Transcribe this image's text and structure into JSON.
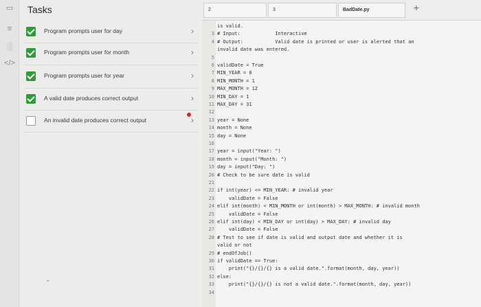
{
  "tasks": {
    "title": "Tasks",
    "items": [
      {
        "label": "Program prompts user for day",
        "done": true
      },
      {
        "label": "Program prompts user for month",
        "done": true
      },
      {
        "label": "Program prompts user for year",
        "done": true
      },
      {
        "label": "A valid date produces correct output",
        "done": true
      },
      {
        "label": "An invalid date produces correct output",
        "done": false
      }
    ]
  },
  "tabs": [
    {
      "label": "2"
    },
    {
      "label": "3"
    },
    {
      "label": "BadDate.py"
    }
  ],
  "editor": {
    "lines": [
      {
        "n": "",
        "t": "is valid."
      },
      {
        "n": "3",
        "t": "# Input:            Interactive"
      },
      {
        "n": "4",
        "t": "# Output:           Valid date is printed or user is alerted that an"
      },
      {
        "n": "",
        "t": "invalid date was entered."
      },
      {
        "n": "5",
        "t": ""
      },
      {
        "n": "6",
        "t": "validDate = True"
      },
      {
        "n": "7",
        "t": "MIN_YEAR = 0"
      },
      {
        "n": "8",
        "t": "MIN_MONTH = 1"
      },
      {
        "n": "9",
        "t": "MAX_MONTH = 12"
      },
      {
        "n": "10",
        "t": "MIN_DAY = 1"
      },
      {
        "n": "11",
        "t": "MAX_DAY = 31"
      },
      {
        "n": "12",
        "t": ""
      },
      {
        "n": "13",
        "t": "year = None"
      },
      {
        "n": "14",
        "t": "month = None"
      },
      {
        "n": "15",
        "t": "day = None"
      },
      {
        "n": "16",
        "t": ""
      },
      {
        "n": "17",
        "t": "year = input(\"Year: \")"
      },
      {
        "n": "18",
        "t": "month = input(\"Month: \")"
      },
      {
        "n": "19",
        "t": "day = input(\"Day: \")"
      },
      {
        "n": "20",
        "t": "# Check to be sure date is valid"
      },
      {
        "n": "21",
        "t": ""
      },
      {
        "n": "22",
        "t": "if int(year) <= MIN_YEAR: # invalid year"
      },
      {
        "n": "23",
        "t": "    validDate = False"
      },
      {
        "n": "24",
        "t": "elif int(month) < MIN_MONTH or int(month) > MAX_MONTH: # invalid month"
      },
      {
        "n": "25",
        "t": "    validDate = False"
      },
      {
        "n": "26",
        "t": "elif int(day) < MIN_DAY or int(day) > MAX_DAY: # invalid day"
      },
      {
        "n": "27",
        "t": "    validDate = False"
      },
      {
        "n": "28",
        "t": "# Test to see if date is valid and output date and whether it is"
      },
      {
        "n": "",
        "t": "valid or not"
      },
      {
        "n": "29",
        "t": "# endOfJob()"
      },
      {
        "n": "30",
        "t": "if validDate == True:"
      },
      {
        "n": "31",
        "t": "    print(\"{}/{}/{} is a valid date.\".format(month, day, year))"
      },
      {
        "n": "32",
        "t": "else:"
      },
      {
        "n": "33",
        "t": "    print(\"{}/{}/{} is not a valid date.\".format(month, day, year))"
      },
      {
        "n": "34",
        "t": ""
      }
    ]
  },
  "colors": {
    "check": "#2f9c3a",
    "error_badge": "#e0222a"
  }
}
